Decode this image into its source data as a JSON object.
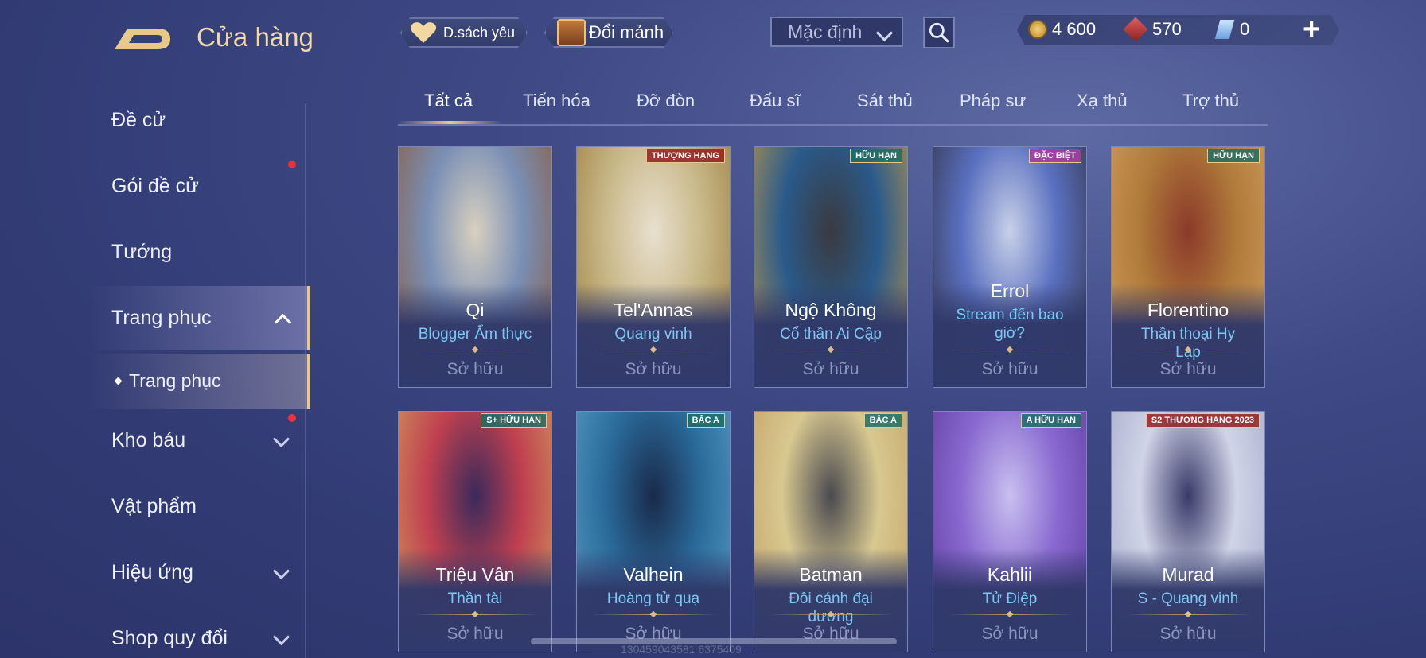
{
  "header": {
    "title": "Cửa hàng",
    "favorites_label": "D.sách yêu",
    "fragments_label": "Đổi mảnh",
    "sort_value": "Mặc định",
    "currencies": [
      {
        "icon": "gold-coin-icon",
        "value": "4 600"
      },
      {
        "icon": "ruby-gem-icon",
        "value": "570"
      },
      {
        "icon": "ticket-icon",
        "value": "0"
      }
    ],
    "add_label": "+"
  },
  "sidebar": {
    "items": [
      {
        "label": "Đề cử"
      },
      {
        "label": "Gói đề cử"
      },
      {
        "label": "Tướng"
      },
      {
        "label": "Trang phục"
      },
      {
        "label": "Trang phục"
      },
      {
        "label": "Kho báu"
      },
      {
        "label": "Vật phẩm"
      },
      {
        "label": "Hiệu ứng"
      },
      {
        "label": "Shop quy đổi"
      }
    ]
  },
  "tabs": [
    "Tất cả",
    "Tiến hóa",
    "Đỡ đòn",
    "Đấu sĩ",
    "Sát thủ",
    "Pháp sư",
    "Xạ thủ",
    "Trợ thủ"
  ],
  "cards": [
    {
      "hero": "Qi",
      "skin": "Blogger Ẩm thực",
      "status": "Sở hữu",
      "badge": "",
      "colors": [
        "#7a8fb5",
        "#d8d0c0",
        "#8a5a3a"
      ]
    },
    {
      "hero": "Tel'Annas",
      "skin": "Quang vinh",
      "status": "Sở hữu",
      "badge": "THƯỢNG HẠNG",
      "colors": [
        "#c9b98a",
        "#e8e0d0",
        "#9a7a3a"
      ]
    },
    {
      "hero": "Ngộ Không",
      "skin": "Cổ thần Ai Cập",
      "status": "Sở hữu",
      "badge": "HỮU HẠN",
      "colors": [
        "#2a5a8a",
        "#3a3a40",
        "#c09a4a"
      ]
    },
    {
      "hero": "Errol",
      "skin": "Stream đến bao giờ?",
      "status": "Sở hữu",
      "badge": "ĐẶC BIỆT",
      "colors": [
        "#5a70c0",
        "#c8d0e8",
        "#303040"
      ]
    },
    {
      "hero": "Florentino",
      "skin": "Thần thoại Hy Lạp",
      "status": "Sở hữu",
      "badge": "HỮU HẠN",
      "colors": [
        "#b07a3a",
        "#8a3a2a",
        "#d0a060"
      ]
    },
    {
      "hero": "Triệu Vân",
      "skin": "Thần tài",
      "status": "Sở hữu",
      "badge": "S+ HỮU HẠN",
      "colors": [
        "#c04050",
        "#3a2a5a",
        "#d0a060"
      ]
    },
    {
      "hero": "Valhein",
      "skin": "Hoàng tử quạ",
      "status": "Sở hữu",
      "badge": "BẬC A",
      "colors": [
        "#2a6a9a",
        "#1a2a4a",
        "#5aa0c8"
      ]
    },
    {
      "hero": "Batman",
      "skin": "Đôi cánh đại dương",
      "status": "Sở hữu",
      "badge": "BẬC A",
      "colors": [
        "#d8c890",
        "#4a4a50",
        "#c0a060"
      ]
    },
    {
      "hero": "Kahlii",
      "skin": "Tử Điệp",
      "status": "Sở hữu",
      "badge": "A HỮU HẠN",
      "colors": [
        "#8a6ad0",
        "#c8c0f0",
        "#5a3a9a"
      ]
    },
    {
      "hero": "Murad",
      "skin": "S - Quang vinh",
      "status": "Sở hữu",
      "badge": "S2 THƯỢNG HẠNG 2023",
      "colors": [
        "#d0d4e8",
        "#3a3a6a",
        "#a0a8c8"
      ]
    }
  ],
  "watermark": "130459043581 6375409"
}
